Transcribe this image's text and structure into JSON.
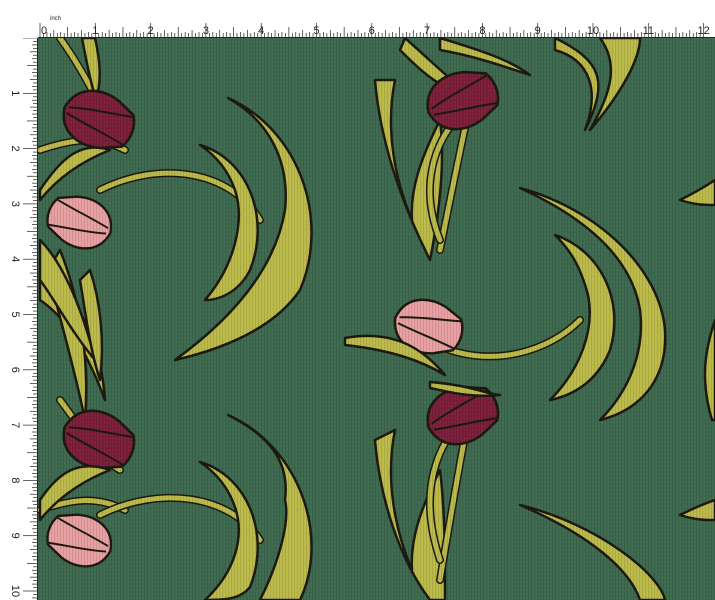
{
  "ruler": {
    "unit_label": "inch",
    "top_numbers": [
      "0",
      "1",
      "2",
      "3",
      "4",
      "5",
      "6",
      "7",
      "8",
      "9",
      "10",
      "11",
      "12"
    ],
    "left_numbers": [
      "1",
      "2",
      "3",
      "4",
      "5",
      "6",
      "7",
      "8",
      "9",
      "10"
    ]
  },
  "colors": {
    "background": "#3e6a50",
    "leaf": "#bcbb4a",
    "outline": "#1c1a10",
    "tulip_dark": "#7d1f3a",
    "tulip_light": "#e9a0a2",
    "ruler_bg": "#ffffff",
    "ruler_ink": "#222222"
  },
  "motifs": {
    "icon": "tulip-leaf-pattern-icon"
  }
}
